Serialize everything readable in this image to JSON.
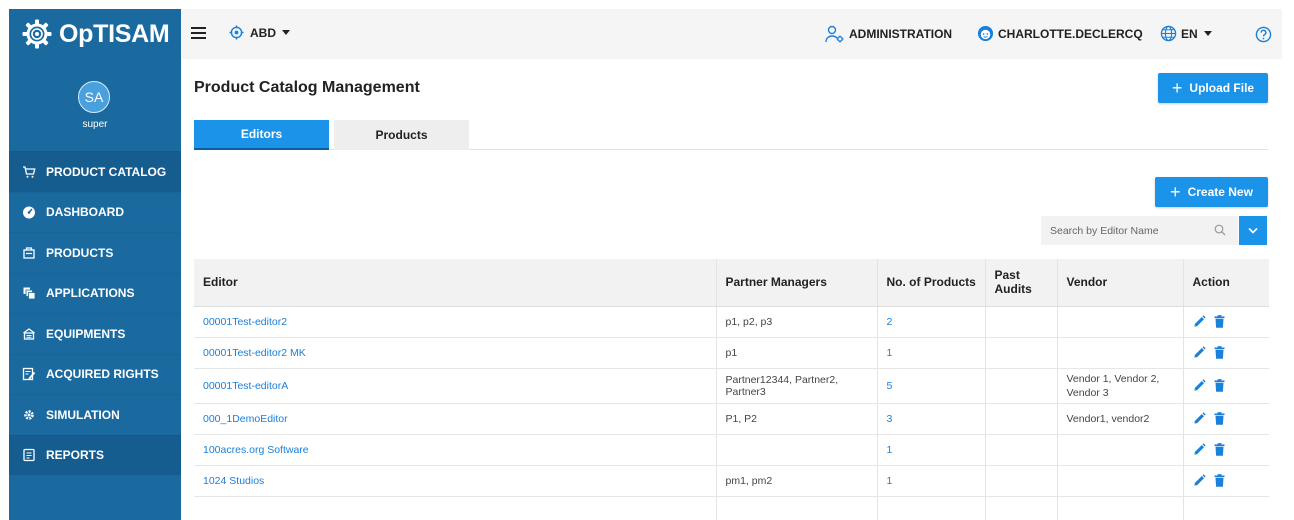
{
  "app": {
    "name": "OpTISAM"
  },
  "topbar": {
    "org": "ABD",
    "administration": "ADMINISTRATION",
    "user": "CHARLOTTE.DECLERCQ",
    "language": "EN"
  },
  "sidebar": {
    "avatar_initials": "SA",
    "user": "super",
    "items": [
      {
        "label": "PRODUCT CATALOG",
        "icon": "cart-icon"
      },
      {
        "label": "DASHBOARD",
        "icon": "dashboard-icon"
      },
      {
        "label": "PRODUCTS",
        "icon": "products-icon"
      },
      {
        "label": "APPLICATIONS",
        "icon": "applications-icon"
      },
      {
        "label": "EQUIPMENTS",
        "icon": "equipments-icon"
      },
      {
        "label": "ACQUIRED RIGHTS",
        "icon": "acquired-rights-icon"
      },
      {
        "label": "SIMULATION",
        "icon": "simulation-icon"
      },
      {
        "label": "REPORTS",
        "icon": "reports-icon"
      }
    ]
  },
  "main": {
    "title": "Product Catalog Management",
    "upload_label": "Upload File",
    "create_label": "Create New",
    "tabs": [
      "Editors",
      "Products"
    ],
    "search_placeholder": "Search by Editor Name"
  },
  "table": {
    "headers": [
      "Editor",
      "Partner Managers",
      "No. of Products",
      "Past Audits",
      "Vendor",
      "Action"
    ],
    "rows": [
      {
        "editor": "00001Test-editor2",
        "partners": "p1, p2, p3",
        "products": "2",
        "audits": "",
        "vendor": ""
      },
      {
        "editor": "00001Test-editor2 MK",
        "partners": "p1",
        "products": "1",
        "audits": "",
        "vendor": ""
      },
      {
        "editor": "00001Test-editorA",
        "partners": "Partner12344, Partner2, Partner3",
        "products": "5",
        "audits": "",
        "vendor": "Vendor 1, Vendor 2, Vendor 3"
      },
      {
        "editor": "000_1DemoEditor",
        "partners": "P1, P2",
        "products": "3",
        "audits": "",
        "vendor": "Vendor1, vendor2"
      },
      {
        "editor": "100acres.org Software",
        "partners": "",
        "products": "1",
        "audits": "",
        "vendor": ""
      },
      {
        "editor": "1024 Studios",
        "partners": "pm1, pm2",
        "products": "1",
        "audits": "",
        "vendor": ""
      }
    ]
  },
  "colors": {
    "sidebar": "#1a6aa0",
    "primary": "#1a93e9",
    "link": "#1a80d9",
    "callout": "#e53935"
  }
}
